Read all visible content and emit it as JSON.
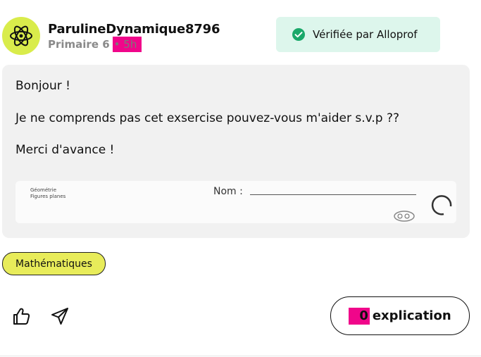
{
  "post": {
    "username": "ParulineDynamique8796",
    "grade": "Primaire 6",
    "time_ago": "• 5h",
    "verified_label": "Vérifiée par Alloprof",
    "body": {
      "greeting": "Bonjour !",
      "question": "Je ne comprends pas cet exsercise pouvez-vous m'aider s.v.p ??",
      "thanks": "Merci d'avance !"
    },
    "attachment": {
      "heading_line1": "Géométrie",
      "heading_line2": "Figures planes",
      "name_field": "Nom :"
    },
    "subject_tag": "Mathématiques"
  },
  "actions": {
    "like_icon": "thumbs-up-icon",
    "share_icon": "send-icon",
    "explanation_count": "0",
    "explanation_label": "explication"
  },
  "colors": {
    "avatar_bg": "#d9ec4b",
    "verified_bg": "#ddf6ec",
    "verified_check": "#1aa86a",
    "tag_bg": "#e8ec5a",
    "highlight": "#f0068a"
  }
}
